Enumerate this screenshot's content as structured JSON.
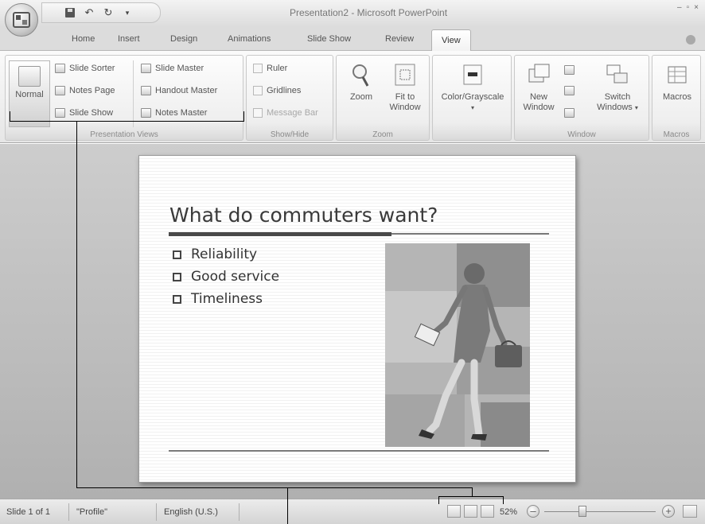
{
  "window": {
    "title": "Presentation2 - Microsoft PowerPoint"
  },
  "tabs": [
    {
      "label": "Home"
    },
    {
      "label": "Insert"
    },
    {
      "label": "Design"
    },
    {
      "label": "Animations"
    },
    {
      "label": "Slide Show"
    },
    {
      "label": "Review"
    },
    {
      "label": "View",
      "active": true
    }
  ],
  "ribbon": {
    "presentation_views": {
      "label": "Presentation Views",
      "normal": "Normal",
      "slide_sorter": "Slide Sorter",
      "notes_page": "Notes Page",
      "slide_show": "Slide Show",
      "slide_master": "Slide Master",
      "handout_master": "Handout Master",
      "notes_master": "Notes Master"
    },
    "show_hide": {
      "label": "Show/Hide",
      "ruler": "Ruler",
      "gridlines": "Gridlines",
      "message_bar": "Message Bar"
    },
    "zoom": {
      "label": "Zoom",
      "zoom": "Zoom",
      "fit_to_window_1": "Fit to",
      "fit_to_window_2": "Window"
    },
    "color": {
      "color_grayscale": "Color/Grayscale"
    },
    "window": {
      "label": "Window",
      "new_window_1": "New",
      "new_window_2": "Window",
      "switch_windows_1": "Switch",
      "switch_windows_2": "Windows"
    },
    "macros": {
      "label": "Macros",
      "macros": "Macros"
    }
  },
  "slide": {
    "title": "What do commuters want?",
    "bullets": [
      "Reliability",
      "Good service",
      "Timeliness"
    ]
  },
  "statusbar": {
    "slide_info": "Slide 1 of 1",
    "theme": "\"Profile\"",
    "language": "English (U.S.)",
    "zoom": "52%"
  },
  "icons": {
    "view_normal": "normal-view-icon",
    "view_sorter": "slide-sorter-icon",
    "view_show": "slide-show-icon",
    "zoom_out": "minus-icon",
    "zoom_in": "plus-icon",
    "fit": "fit-window-icon"
  }
}
